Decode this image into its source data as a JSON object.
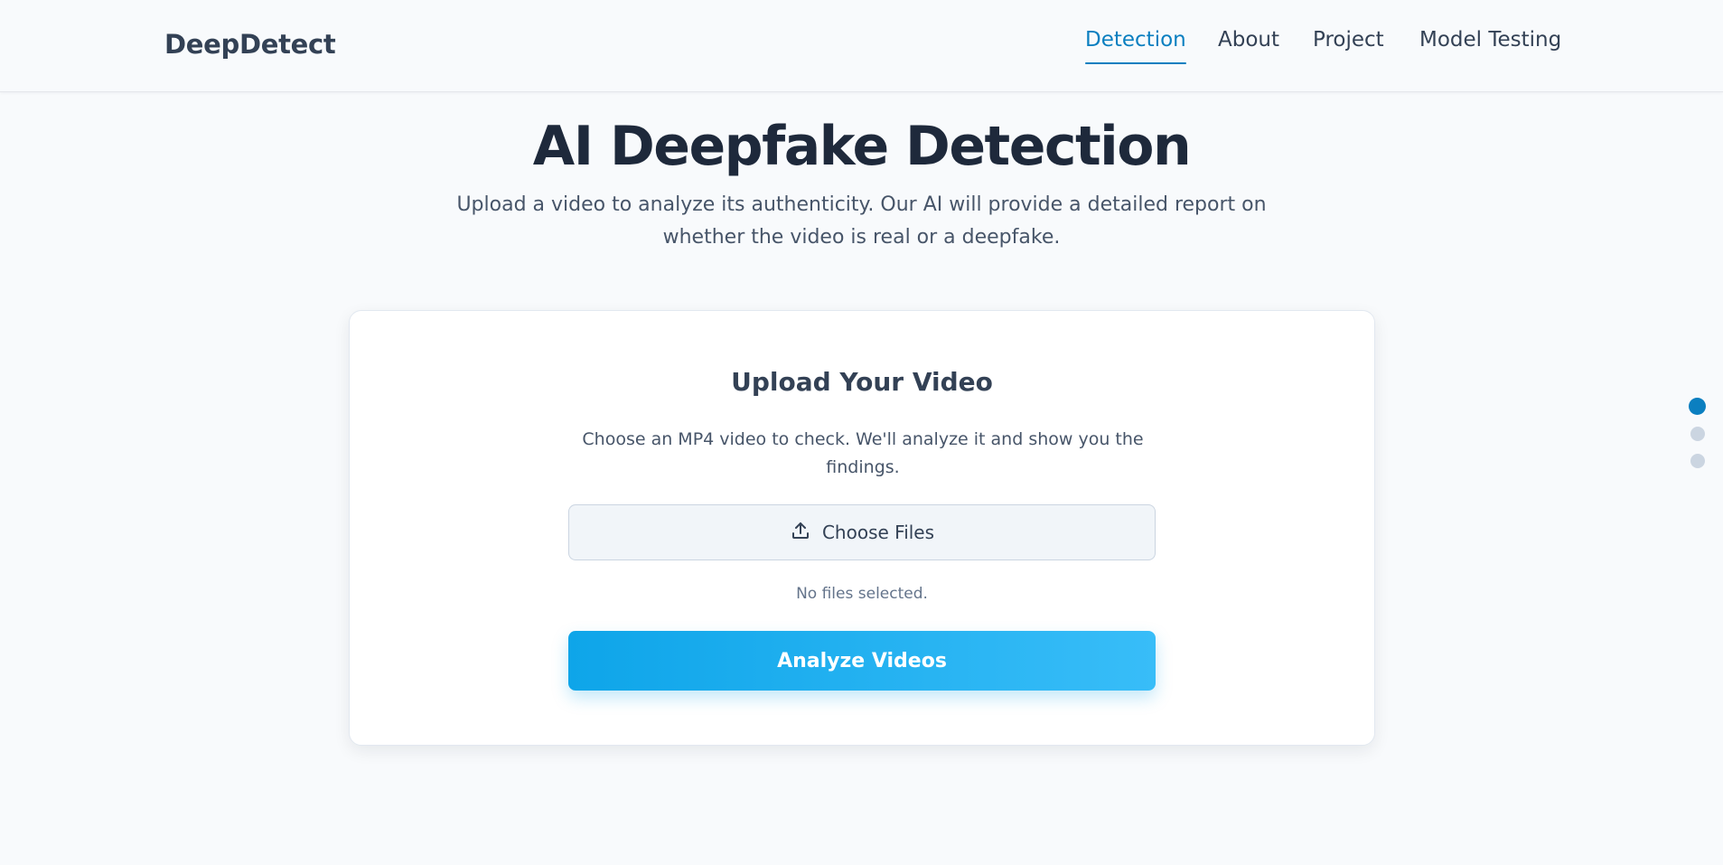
{
  "header": {
    "brand": "DeepDetect",
    "nav": [
      {
        "label": "Detection",
        "active": true
      },
      {
        "label": "About",
        "active": false
      },
      {
        "label": "Project",
        "active": false
      },
      {
        "label": "Model Testing",
        "active": false
      }
    ]
  },
  "hero": {
    "title": "AI Deepfake Detection",
    "subtitle": "Upload a video to analyze its authenticity. Our AI will provide a detailed report on whether the video is real or a deepfake."
  },
  "upload_card": {
    "title": "Upload Your Video",
    "description": "Choose an MP4 video to check. We'll analyze it and show you the findings.",
    "choose_button_label": "Choose Files",
    "choose_button_icon": "upload-icon",
    "file_status": "No files selected.",
    "analyze_button_label": "Analyze Videos"
  },
  "section_indicator": {
    "count": 3,
    "active_index": 0
  },
  "colors": {
    "accent": "#0b7fc0",
    "button_gradient_start": "#0ea5e9",
    "button_gradient_end": "#38bdf8",
    "background": "#f8fafc"
  }
}
